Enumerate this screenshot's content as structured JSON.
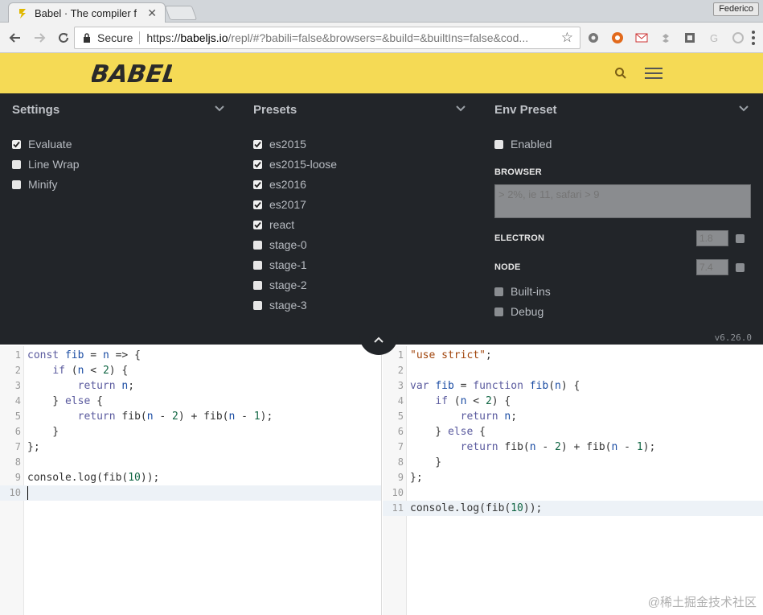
{
  "browser": {
    "tab_title": "Babel · The compiler f",
    "profile_name": "Federico",
    "secure_label": "Secure",
    "url_scheme": "https://",
    "url_host": "babeljs.io",
    "url_rest": "/repl/#?babili=false&browsers=&build=&builtIns=false&cod..."
  },
  "header": {
    "logo_text": "BABEL"
  },
  "settings": {
    "title": "Settings",
    "options": [
      {
        "label": "Evaluate",
        "checked": true
      },
      {
        "label": "Line Wrap",
        "checked": false
      },
      {
        "label": "Minify",
        "checked": false
      }
    ]
  },
  "presets": {
    "title": "Presets",
    "options": [
      {
        "label": "es2015",
        "checked": true
      },
      {
        "label": "es2015-loose",
        "checked": true
      },
      {
        "label": "es2016",
        "checked": true
      },
      {
        "label": "es2017",
        "checked": true
      },
      {
        "label": "react",
        "checked": true
      },
      {
        "label": "stage-0",
        "checked": false
      },
      {
        "label": "stage-1",
        "checked": false
      },
      {
        "label": "stage-2",
        "checked": false
      },
      {
        "label": "stage-3",
        "checked": false
      }
    ]
  },
  "env": {
    "title": "Env Preset",
    "enabled_label": "Enabled",
    "browser_label": "BROWSER",
    "browser_placeholder": "> 2%, ie 11, safari > 9",
    "electron_label": "ELECTRON",
    "electron_value": "1.8",
    "node_label": "NODE",
    "node_value": "7.4",
    "builtins_label": "Built-ins",
    "debug_label": "Debug",
    "version": "v6.26.0"
  },
  "input_code": [
    "const fib = n => {",
    "    if (n < 2) {",
    "        return n;",
    "    } else {",
    "        return fib(n - 2) + fib(n - 1);",
    "    }",
    "};",
    "",
    "console.log(fib(10));",
    ""
  ],
  "output_code": [
    "\"use strict\";",
    "",
    "var fib = function fib(n) {",
    "    if (n < 2) {",
    "        return n;",
    "    } else {",
    "        return fib(n - 2) + fib(n - 1);",
    "    }",
    "};",
    "",
    "console.log(fib(10));"
  ],
  "watermark": "@稀土掘金技术社区"
}
